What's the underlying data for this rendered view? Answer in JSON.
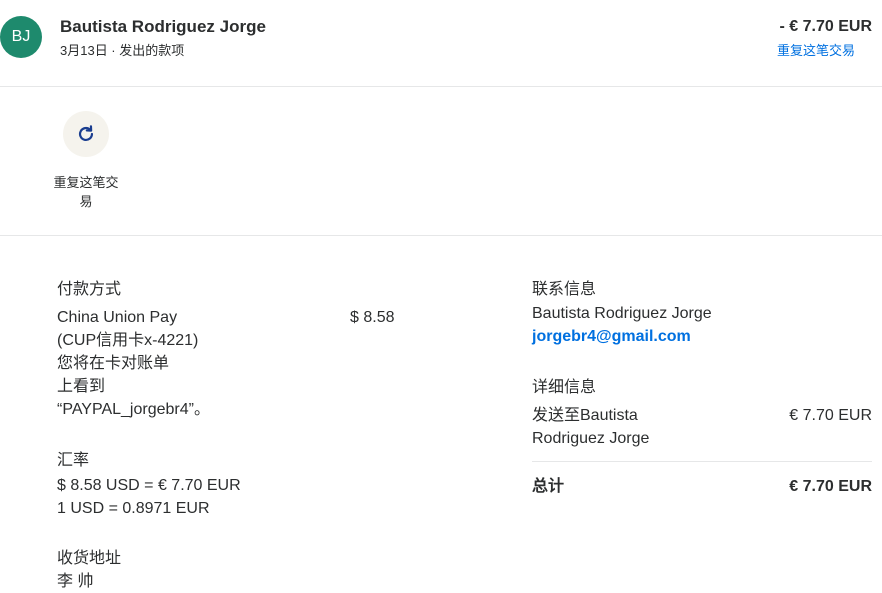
{
  "header": {
    "avatar_initials": "BJ",
    "name": "Bautista Rodriguez Jorge",
    "subline": "3月13日 · 发出的款项",
    "amount": "- € 7.70 EUR",
    "repeat_link": "重复这笔交易"
  },
  "actions": {
    "repeat_label": "重复这笔交易"
  },
  "payment": {
    "heading": "付款方式",
    "method_lines": [
      "China Union Pay",
      "(CUP信用卡x-4221)",
      "您将在卡对账单",
      "上看到",
      "“PAYPAL_jorgebr4”。"
    ],
    "amount": "$ 8.58"
  },
  "exchange": {
    "heading": "汇率",
    "line1": "$ 8.58 USD = € 7.70 EUR",
    "line2": "1 USD = 0.8971 EUR"
  },
  "shipping": {
    "heading": "收货地址",
    "name": "李 帅"
  },
  "contact": {
    "heading": "联系信息",
    "name": "Bautista Rodriguez Jorge",
    "email": "jorgebr4@gmail.com"
  },
  "details": {
    "heading": "详细信息",
    "sent_to_lines": [
      "发送至Bautista",
      "Rodriguez Jorge"
    ],
    "sent_amount": "€ 7.70 EUR",
    "total_label": "总计",
    "total_amount": "€ 7.70 EUR"
  },
  "colors": {
    "avatar_bg": "#1e8a6d",
    "link": "#0070e0",
    "icon": "#1a3d8f"
  }
}
